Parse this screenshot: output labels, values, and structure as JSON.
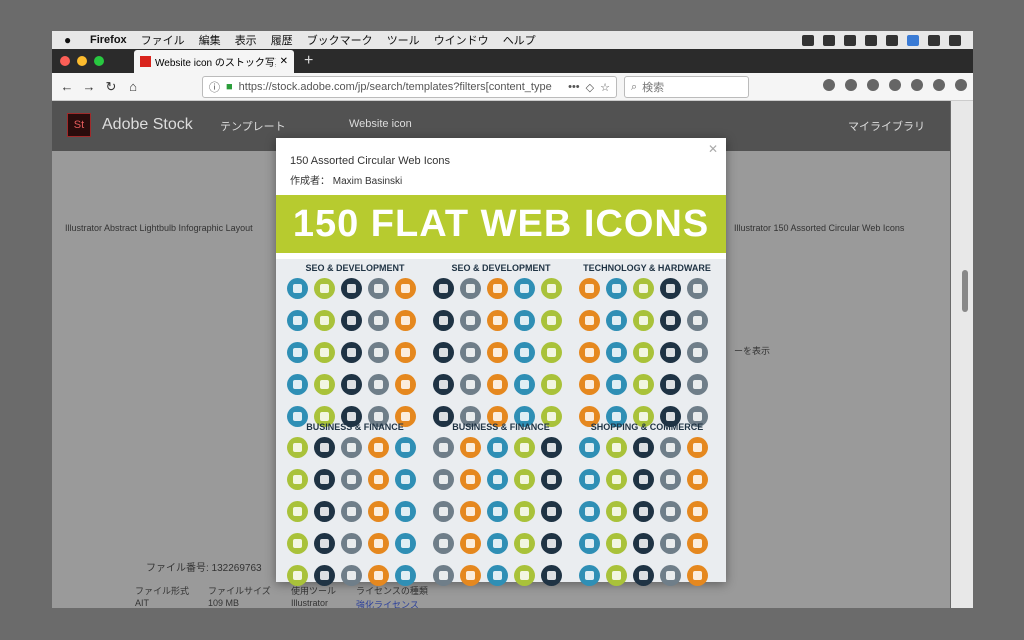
{
  "menubar": {
    "app": "Firefox",
    "items": [
      "ファイル",
      "編集",
      "表示",
      "履歴",
      "ブックマーク",
      "ツール",
      "ウインドウ",
      "ヘルプ"
    ]
  },
  "tab": {
    "title": "Website icon のストック写真、"
  },
  "nav": {
    "url": "https://stock.adobe.com/jp/search/templates?filters[content_type",
    "search_placeholder": "検索"
  },
  "stock": {
    "brand": "Adobe Stock",
    "section": "テンプレート",
    "query": "Website icon",
    "mylib": "マイライブラリ",
    "card_left": "Illustrator Abstract Lightbulb Infographic Layout",
    "card_right": "Illustrator 150 Assorted Circular Web Icons",
    "file_label": "ファイル番号: 132269763",
    "meta_headers": [
      "ファイル形式",
      "ファイルサイズ",
      "使用ツール",
      "ライセンスの種類"
    ],
    "meta_values": [
      "AIT",
      "109 MB",
      "Illustrator",
      "強化ライセンス"
    ],
    "view_more": "ーを表示"
  },
  "modal": {
    "title": "150 Assorted Circular Web Icons",
    "author": "作成者：  Maxim Basinski",
    "banner": "150 FLAT WEB ICONS",
    "sections": [
      "SEO & DEVELOPMENT",
      "SEO & DEVELOPMENT",
      "TECHNOLOGY & HARDWARE",
      "BUSINESS & FINANCE",
      "BUSINESS & FINANCE",
      "SHOPPING & COMMERCE"
    ]
  },
  "colors": {
    "accent": "#b7cb2f",
    "icon_palette": [
      "#2f8fb5",
      "#1f3344",
      "#e5881f",
      "#a9c23a",
      "#6f7e89"
    ]
  }
}
